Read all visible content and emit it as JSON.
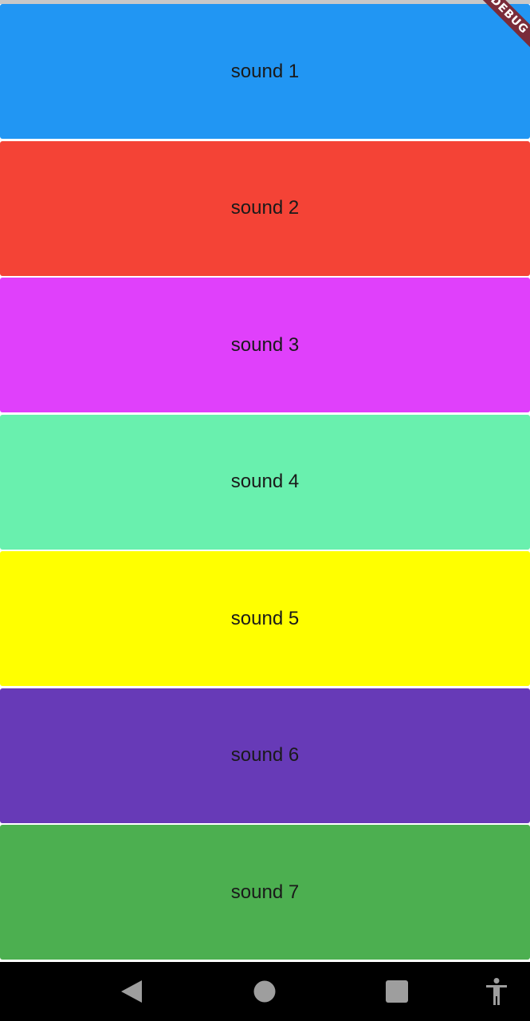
{
  "sounds": [
    {
      "label": "sound 1",
      "color": "#2196F3"
    },
    {
      "label": "sound 2",
      "color": "#F44336"
    },
    {
      "label": "sound 3",
      "color": "#E040FB"
    },
    {
      "label": "sound 4",
      "color": "#69F0AE"
    },
    {
      "label": "sound 5",
      "color": "#FFFF00"
    },
    {
      "label": "sound 6",
      "color": "#673AB7"
    },
    {
      "label": "sound 7",
      "color": "#4CAF50"
    }
  ],
  "debug_banner": {
    "label": "DEBUG"
  },
  "navbar": {
    "buttons": [
      {
        "icon": "back-icon"
      },
      {
        "icon": "home-icon"
      },
      {
        "icon": "recents-icon"
      },
      {
        "icon": "accessibility-icon"
      }
    ],
    "icon_color": "#9e9e9e",
    "background": "#000000"
  }
}
